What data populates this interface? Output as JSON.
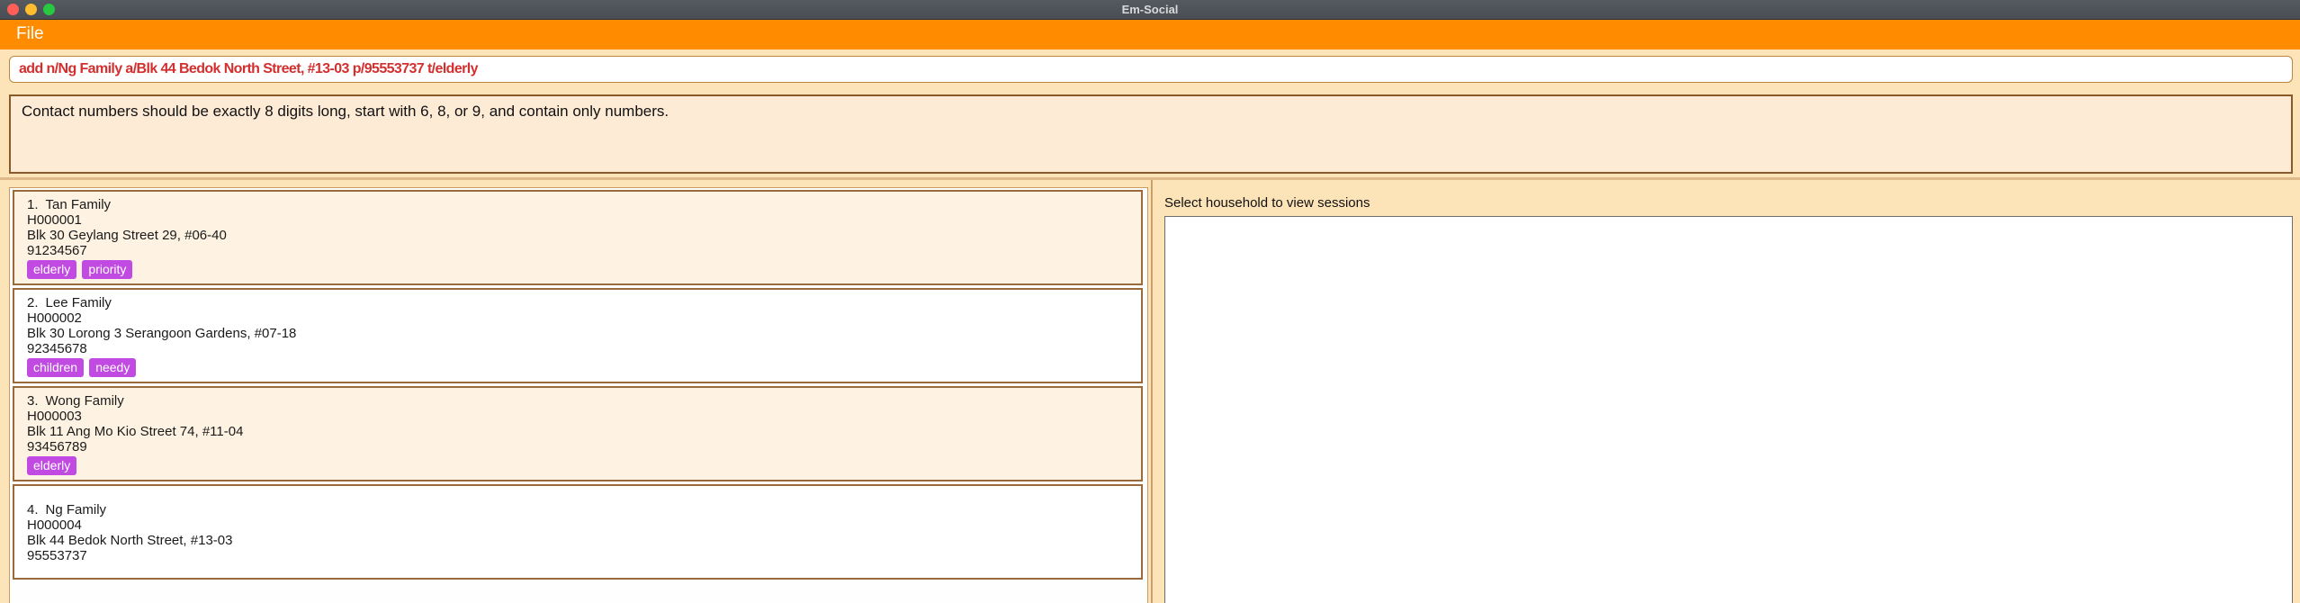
{
  "window": {
    "title": "Em-Social"
  },
  "menu": {
    "file": "File"
  },
  "command": {
    "text": "add n/Ng Family a/Blk 44 Bedok North Street, #13-03 p/95553737 t/elderly"
  },
  "result": {
    "message": "Contact numbers should be exactly 8 digits long, start with 6, 8, or 9, and contain only numbers."
  },
  "households": [
    {
      "index": "1.",
      "name": "Tan Family",
      "id": "H000001",
      "address": "Blk 30 Geylang Street 29, #06-40",
      "phone": "91234567",
      "tags": [
        "elderly",
        "priority"
      ]
    },
    {
      "index": "2.",
      "name": "Lee Family",
      "id": "H000002",
      "address": "Blk 30 Lorong 3 Serangoon Gardens, #07-18",
      "phone": "92345678",
      "tags": [
        "children",
        "needy"
      ]
    },
    {
      "index": "3.",
      "name": "Wong Family",
      "id": "H000003",
      "address": "Blk 11 Ang Mo Kio Street 74, #11-04",
      "phone": "93456789",
      "tags": [
        "elderly"
      ]
    },
    {
      "index": "4.",
      "name": "Ng Family",
      "id": "H000004",
      "address": "Blk 44 Bedok North Street, #13-03",
      "phone": "95553737",
      "tags": []
    }
  ],
  "sessions": {
    "label": "Select household to view sessions"
  },
  "colors": {
    "accent": "#ff8c00",
    "tag": "#c04ae2",
    "error_text": "#d32f2f",
    "background": "#fde3b8"
  }
}
